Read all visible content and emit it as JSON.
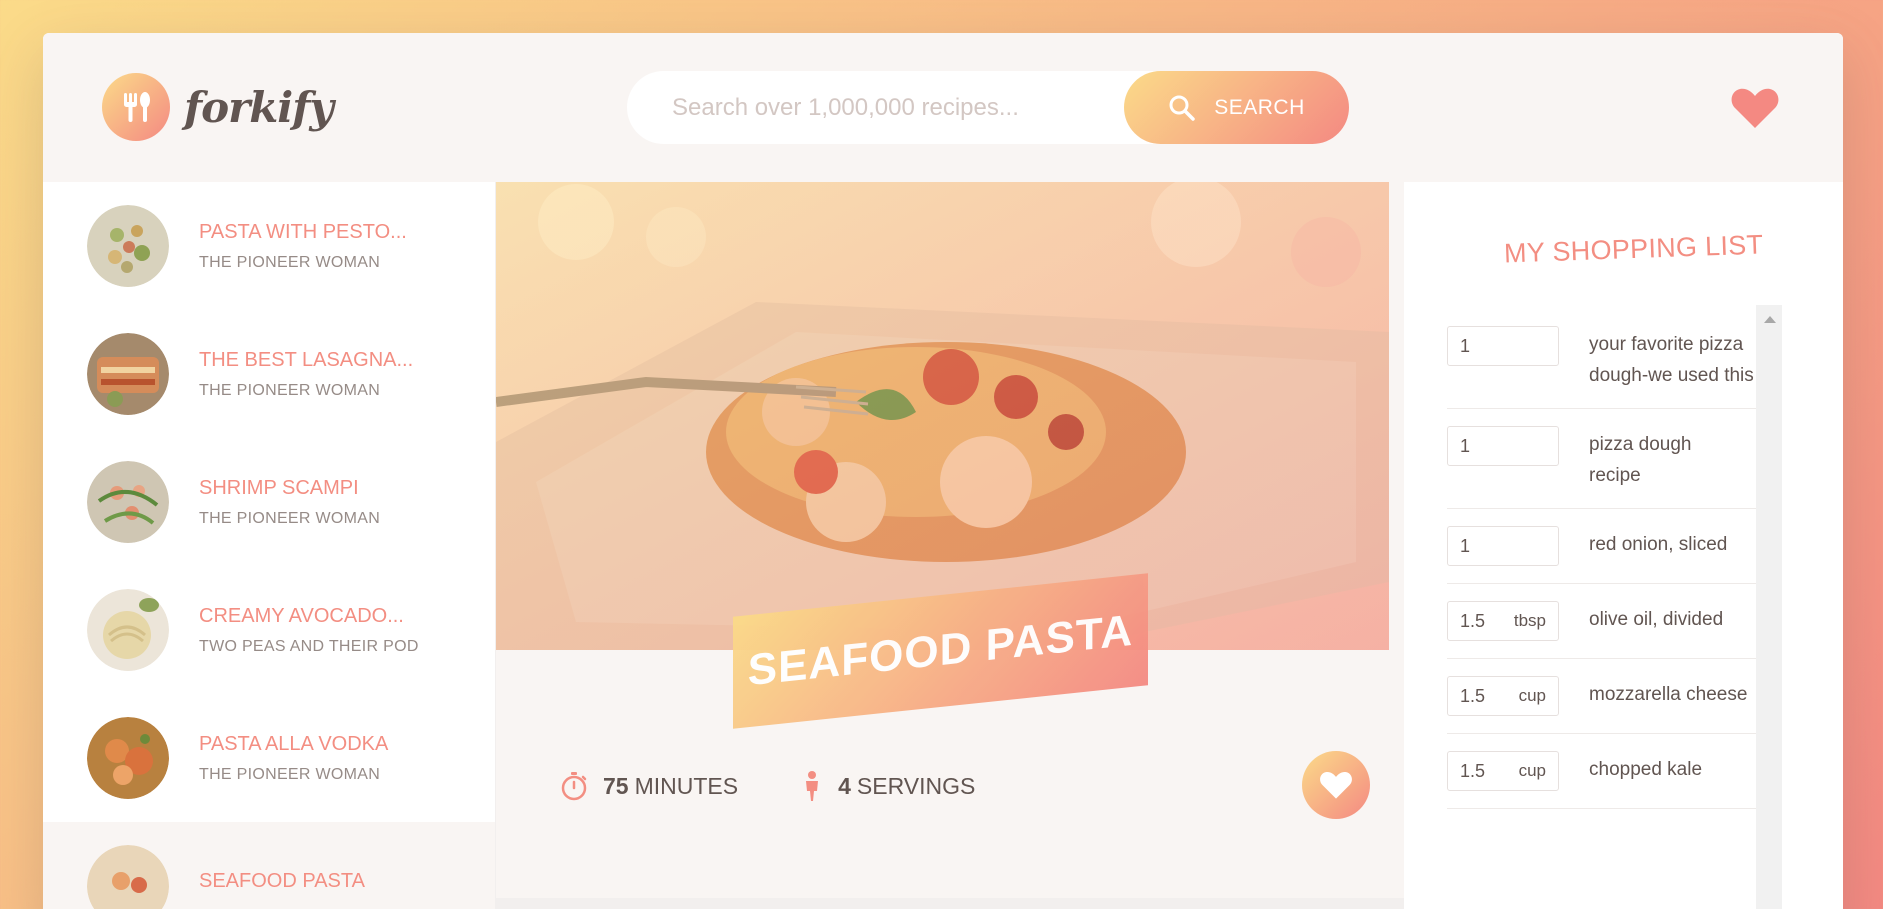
{
  "header": {
    "logo_text": "forkify",
    "search_placeholder": "Search over 1,000,000 recipes...",
    "search_button": "SEARCH"
  },
  "results": [
    {
      "name": "Pasta with pesto...",
      "author": "The Pioneer Woman"
    },
    {
      "name": "The best lasagna...",
      "author": "The Pioneer Woman"
    },
    {
      "name": "Shrimp scampi",
      "author": "The Pioneer Woman"
    },
    {
      "name": "Creamy avocado...",
      "author": "Two Peas and Their Pod"
    },
    {
      "name": "Pasta alla vodka",
      "author": "The Pioneer Woman"
    },
    {
      "name": "Seafood pasta",
      "author": ""
    }
  ],
  "recipe": {
    "title": "SEAFOOD PASTA",
    "minutes_value": "75",
    "minutes_label": "MINUTES",
    "servings_value": "4",
    "servings_label": "SERVINGS"
  },
  "shopping": {
    "title": "MY SHOPPING LIST",
    "items": [
      {
        "count": "1",
        "unit": "",
        "desc": "your favorite pizza dough-we used this"
      },
      {
        "count": "1",
        "unit": "",
        "desc": "pizza dough recipe"
      },
      {
        "count": "1",
        "unit": "",
        "desc": "red onion, sliced"
      },
      {
        "count": "1.5",
        "unit": "tbsp",
        "desc": "olive oil, divided"
      },
      {
        "count": "1.5",
        "unit": "cup",
        "desc": "mozzarella cheese"
      },
      {
        "count": "1.5",
        "unit": "cup",
        "desc": "chopped kale"
      }
    ]
  },
  "colors": {
    "accent_start": "#fbdb89",
    "accent_end": "#f48982",
    "text": "#615551",
    "result_name": "#f38e82"
  }
}
